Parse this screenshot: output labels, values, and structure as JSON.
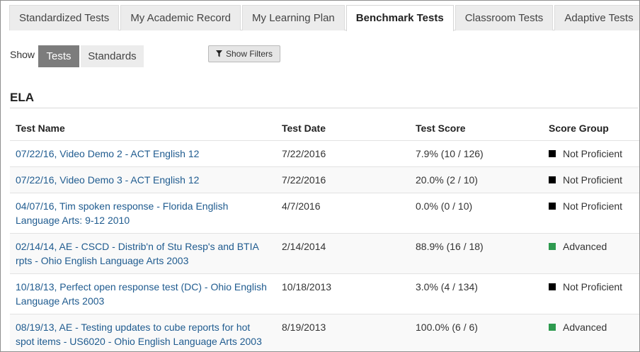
{
  "tabs": [
    {
      "label": "Standardized Tests",
      "active": false
    },
    {
      "label": "My Academic Record",
      "active": false
    },
    {
      "label": "My Learning Plan",
      "active": false
    },
    {
      "label": "Benchmark Tests",
      "active": true
    },
    {
      "label": "Classroom Tests",
      "active": false
    },
    {
      "label": "Adaptive Tests",
      "active": false
    }
  ],
  "show": {
    "label": "Show",
    "options": [
      "Tests",
      "Standards"
    ],
    "selected": "Tests"
  },
  "filters": {
    "label": "Show Filters",
    "icon": "filter-icon"
  },
  "section": {
    "title": "ELA"
  },
  "table": {
    "headers": [
      "Test Name",
      "Test Date",
      "Test Score",
      "Score Group"
    ],
    "rows": [
      {
        "name": "07/22/16, Video Demo 2 - ACT English 12",
        "date": "7/22/2016",
        "score": "7.9% (10 / 126)",
        "group": "Not Proficient",
        "group_color": "#000000"
      },
      {
        "name": "07/22/16, Video Demo 3 - ACT English 12",
        "date": "7/22/2016",
        "score": "20.0% (2 / 10)",
        "group": "Not Proficient",
        "group_color": "#000000"
      },
      {
        "name": "04/07/16, Tim spoken response - Florida English Language Arts: 9-12 2010",
        "date": "4/7/2016",
        "score": "0.0% (0 / 10)",
        "group": "Not Proficient",
        "group_color": "#000000"
      },
      {
        "name": "02/14/14, AE - CSCD - Distrib'n of Stu Resp's and BTIA rpts - Ohio English Language Arts 2003",
        "date": "2/14/2014",
        "score": "88.9% (16 / 18)",
        "group": "Advanced",
        "group_color": "#2e9a4f"
      },
      {
        "name": "10/18/13, Perfect open response test (DC) - Ohio English Language Arts 2003",
        "date": "10/18/2013",
        "score": "3.0% (4 / 134)",
        "group": "Not Proficient",
        "group_color": "#000000"
      },
      {
        "name": "08/19/13, AE - Testing updates to cube reports for hot spot items - US6020 - Ohio English Language Arts 2003",
        "date": "8/19/2013",
        "score": "100.0% (6 / 6)",
        "group": "Advanced",
        "group_color": "#2e9a4f"
      }
    ]
  },
  "colors": {
    "link": "#1f5b8f",
    "not_proficient": "#000000",
    "advanced": "#2e9a4f",
    "selected_toggle": "#7c7c7c"
  }
}
